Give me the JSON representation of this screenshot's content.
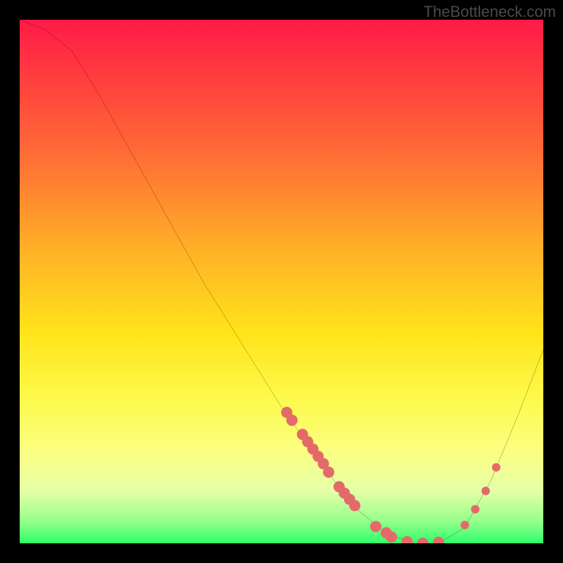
{
  "watermark": "TheBottleneck.com",
  "chart_data": {
    "type": "line",
    "title": "",
    "xlabel": "",
    "ylabel": "",
    "xlim": [
      0,
      100
    ],
    "ylim": [
      0,
      100
    ],
    "curve": [
      {
        "x": 0,
        "y": 100
      },
      {
        "x": 5,
        "y": 98
      },
      {
        "x": 10,
        "y": 94
      },
      {
        "x": 15,
        "y": 86
      },
      {
        "x": 20,
        "y": 77
      },
      {
        "x": 25,
        "y": 68
      },
      {
        "x": 30,
        "y": 59
      },
      {
        "x": 35,
        "y": 50
      },
      {
        "x": 40,
        "y": 42
      },
      {
        "x": 45,
        "y": 34
      },
      {
        "x": 50,
        "y": 26
      },
      {
        "x": 55,
        "y": 19
      },
      {
        "x": 60,
        "y": 12
      },
      {
        "x": 65,
        "y": 6
      },
      {
        "x": 70,
        "y": 2
      },
      {
        "x": 75,
        "y": 0
      },
      {
        "x": 80,
        "y": 0
      },
      {
        "x": 85,
        "y": 3
      },
      {
        "x": 90,
        "y": 12
      },
      {
        "x": 95,
        "y": 24
      },
      {
        "x": 100,
        "y": 37
      }
    ],
    "markers_left": [
      {
        "x": 51,
        "y": 25.0
      },
      {
        "x": 52,
        "y": 23.5
      },
      {
        "x": 54,
        "y": 20.8
      },
      {
        "x": 55,
        "y": 19.4
      },
      {
        "x": 56,
        "y": 18.0
      },
      {
        "x": 57,
        "y": 16.6
      },
      {
        "x": 58,
        "y": 15.2
      },
      {
        "x": 59,
        "y": 13.6
      },
      {
        "x": 61,
        "y": 10.8
      },
      {
        "x": 62,
        "y": 9.6
      },
      {
        "x": 63,
        "y": 8.4
      },
      {
        "x": 64,
        "y": 7.2
      }
    ],
    "markers_bottom": [
      {
        "x": 68,
        "y": 3.2
      },
      {
        "x": 70,
        "y": 2.0
      },
      {
        "x": 71,
        "y": 1.2
      },
      {
        "x": 74,
        "y": 0.3
      },
      {
        "x": 77,
        "y": 0.0
      },
      {
        "x": 80,
        "y": 0.2
      }
    ],
    "markers_right": [
      {
        "x": 85,
        "y": 3.5
      },
      {
        "x": 87,
        "y": 6.5
      },
      {
        "x": 89,
        "y": 10.0
      },
      {
        "x": 91,
        "y": 14.5
      }
    ],
    "marker_color": "#e46a6a",
    "marker_radius": 8,
    "marker_radius_small": 6
  }
}
